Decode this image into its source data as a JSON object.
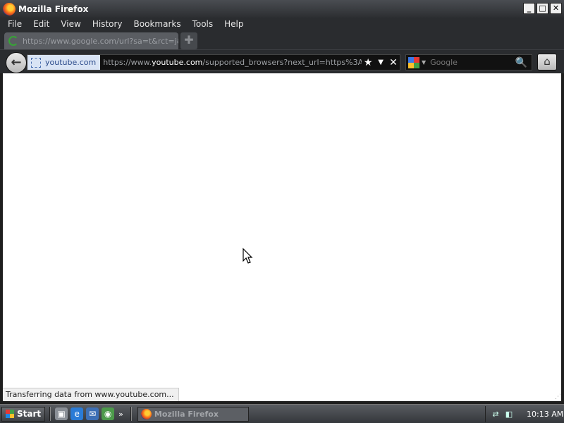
{
  "window": {
    "title": "Mozilla Firefox",
    "controls": {
      "minimize": "_",
      "maximize": "□",
      "close": "✕"
    }
  },
  "menu": [
    "File",
    "Edit",
    "View",
    "History",
    "Bookmarks",
    "Tools",
    "Help"
  ],
  "tab": {
    "label": "https://www.google.com/url?sa=t&rct=j&q",
    "state": "loading",
    "new_tab_symbol": "✚"
  },
  "navbar": {
    "back_symbol": "←",
    "identity_label": "youtube.com",
    "url_prefix": "https://www.",
    "url_domain": "youtube.com",
    "url_rest": "/supported_browsers?next_url=https%3A%2F%",
    "bookmark_symbol": "★",
    "dropdown_symbol": "▼",
    "stop_symbol": "✕",
    "search_placeholder": "Google",
    "search_go_symbol": "🔍",
    "home_symbol": "⌂"
  },
  "status": {
    "text": "Transferring data from www.youtube.com..."
  },
  "taskbar": {
    "start_label": "Start",
    "quicklaunch_more": "»",
    "task_label": "Mozilla Firefox",
    "clock": "10:13 AM"
  },
  "colors": {
    "identity_bg": "#d9e4f5",
    "spinner": "#37a336",
    "content_bg": "#ffffff"
  },
  "icons": [
    "firefox-icon",
    "loading-spinner-icon",
    "back-arrow-icon",
    "site-identity-icon",
    "star-icon",
    "dropdown-icon",
    "stop-icon",
    "google-icon",
    "magnifier-icon",
    "home-icon",
    "windows-logo-icon",
    "mouse-cursor-icon"
  ]
}
